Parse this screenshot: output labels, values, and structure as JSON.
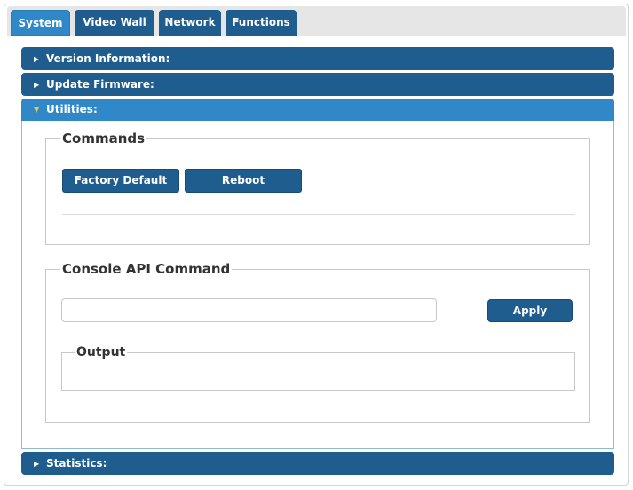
{
  "tabs": [
    {
      "label": "System",
      "active": true
    },
    {
      "label": "Video Wall",
      "active": false
    },
    {
      "label": "Network",
      "active": false
    },
    {
      "label": "Functions",
      "active": false
    }
  ],
  "sections": {
    "version": {
      "label": "Version Information:",
      "expanded": false
    },
    "firmware": {
      "label": "Update Firmware:",
      "expanded": false
    },
    "utilities": {
      "label": "Utilities:",
      "expanded": true
    },
    "statistics": {
      "label": "Statistics:",
      "expanded": false
    }
  },
  "commands": {
    "legend": "Commands",
    "factory_default_label": "Factory Default",
    "reboot_label": "Reboot"
  },
  "console": {
    "legend": "Console API Command",
    "input_value": "",
    "apply_label": "Apply",
    "output_legend": "Output",
    "output_text": ""
  },
  "colors": {
    "header_blue": "#1e5d8e",
    "active_blue": "#3088c9",
    "caret_open": "#f2c14e"
  },
  "icons": {
    "collapsed_caret": "caret-right-icon",
    "expanded_caret": "caret-down-icon"
  }
}
